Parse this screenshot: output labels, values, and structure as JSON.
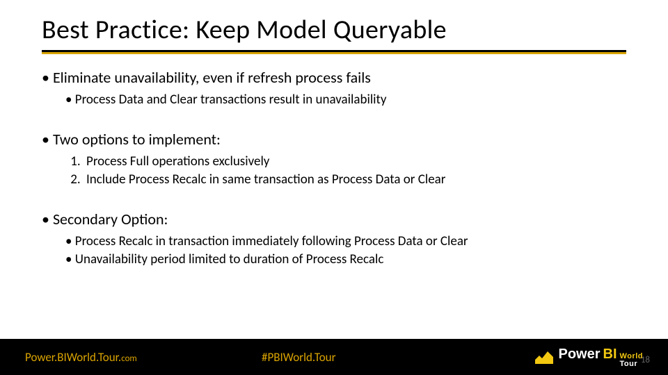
{
  "title": "Best Practice: Keep Model Queryable",
  "bullets": {
    "b1": "Eliminate unavailability, even if refresh process fails",
    "b1_sub": {
      "s1": "Process Data and Clear transactions result in unavailability"
    },
    "b2": "Two options to implement:",
    "b2_ol": {
      "o1": "Process Full operations exclusively",
      "o2": "Include Process Recalc in same transaction as Process Data or Clear"
    },
    "b3": "Secondary Option:",
    "b3_sub": {
      "s1": "Process Recalc in transaction immediately following Process Data or Clear",
      "s2": "Unavailability period limited to duration of Process Recalc"
    }
  },
  "footer": {
    "url_main": "Power.BIWorld.Tour.",
    "url_tld": "com",
    "hashtag": "#PBIWorld.Tour",
    "brand_power": "Power",
    "brand_bi": "BI",
    "brand_world": "World",
    "brand_tour": "Tour"
  },
  "page_number": "18"
}
